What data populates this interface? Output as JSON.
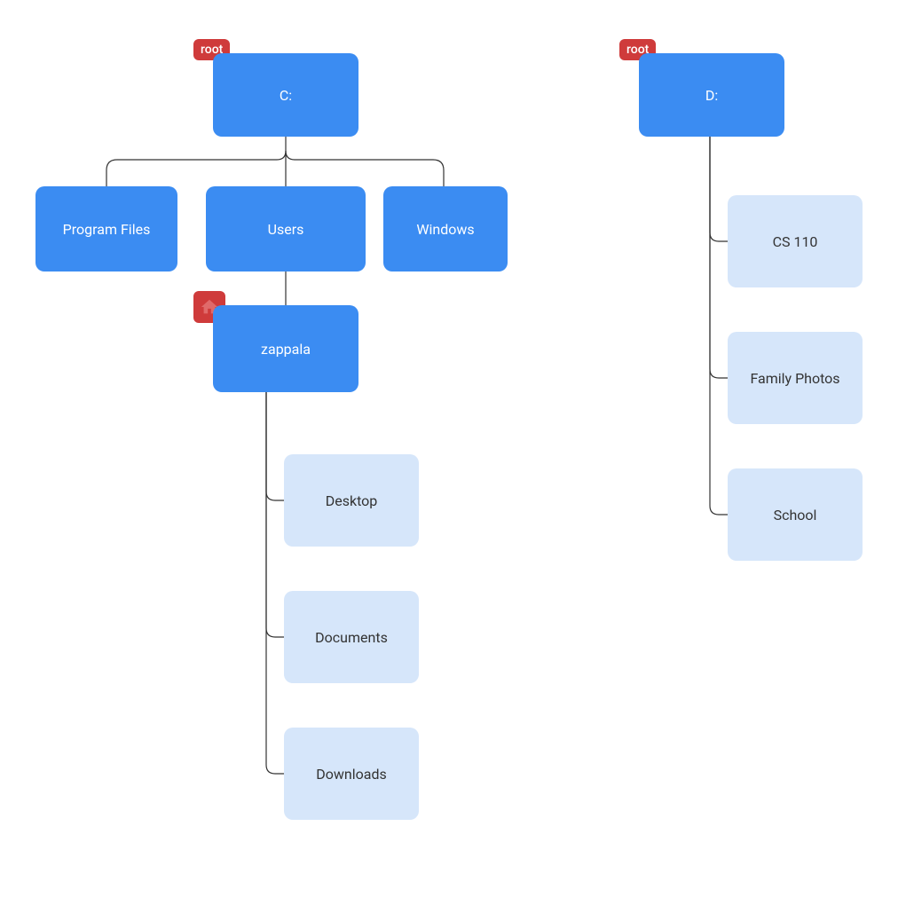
{
  "colors": {
    "node_blue": "#3b8cf2",
    "node_light": "#d6e6fa",
    "badge_red": "#cf3b3b",
    "connector": "#333333"
  },
  "badges": {
    "root_c": "root",
    "root_d": "root",
    "home_icon": "home-icon"
  },
  "tree_c": {
    "root": "C:",
    "children": [
      "Program Files",
      "Users",
      "Windows"
    ],
    "users_child": "zappala",
    "zappala_children": [
      "Desktop",
      "Documents",
      "Downloads"
    ]
  },
  "tree_d": {
    "root": "D:",
    "children": [
      "CS 110",
      "Family Photos",
      "School"
    ]
  }
}
